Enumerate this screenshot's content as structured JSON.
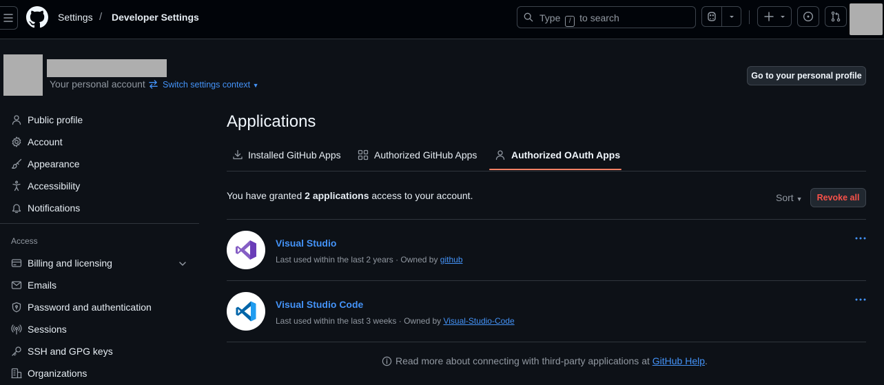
{
  "header": {
    "breadcrumb": [
      "Settings",
      "Developer Settings"
    ],
    "separator": "/",
    "search_prefix": "Type",
    "search_key": "/",
    "search_suffix": "to search"
  },
  "account": {
    "subtitle": "Your personal account",
    "switch_label": "Switch settings context",
    "profile_button": "Go to your personal profile"
  },
  "sidebar": {
    "items": [
      {
        "label": "Public profile",
        "icon": "person-icon"
      },
      {
        "label": "Account",
        "icon": "gear-icon"
      },
      {
        "label": "Appearance",
        "icon": "paintbrush-icon"
      },
      {
        "label": "Accessibility",
        "icon": "accessibility-icon"
      },
      {
        "label": "Notifications",
        "icon": "bell-icon"
      }
    ],
    "access_heading": "Access",
    "access_items": [
      {
        "label": "Billing and licensing",
        "icon": "credit-card-icon"
      },
      {
        "label": "Emails",
        "icon": "mail-icon"
      },
      {
        "label": "Password and authentication",
        "icon": "shield-lock-icon"
      },
      {
        "label": "Sessions",
        "icon": "broadcast-icon"
      },
      {
        "label": "SSH and GPG keys",
        "icon": "key-icon"
      },
      {
        "label": "Organizations",
        "icon": "organization-icon"
      }
    ]
  },
  "main": {
    "title": "Applications",
    "tabs": [
      {
        "label": "Installed GitHub Apps",
        "icon": "download-icon"
      },
      {
        "label": "Authorized GitHub Apps",
        "icon": "apps-icon"
      },
      {
        "label": "Authorized OAuth Apps",
        "icon": "person-icon",
        "selected": true
      }
    ],
    "grant_prefix": "You have granted",
    "grant_count": "2 applications",
    "grant_suffix": "access to your account.",
    "sort_label": "Sort",
    "revoke_label": "Revoke all",
    "apps": [
      {
        "name": "Visual Studio",
        "meta": "Last used within the last 2 years · Owned by",
        "owner": "github",
        "logo": "visual-studio-logo",
        "color": "#865fc5"
      },
      {
        "name": "Visual Studio Code",
        "meta": "Last used within the last 3 weeks · Owned by",
        "owner": "Visual-Studio-Code",
        "logo": "vscode-logo",
        "color": "#1f9cf0"
      }
    ],
    "footnote_text": "Read more about connecting with third-party applications at",
    "footnote_link": "GitHub Help",
    "footnote_end": "."
  },
  "colors": {
    "background": "#0d1117",
    "header": "#010409",
    "link": "#4493f8",
    "danger": "#f85149",
    "tab_underline": "#f78166"
  }
}
